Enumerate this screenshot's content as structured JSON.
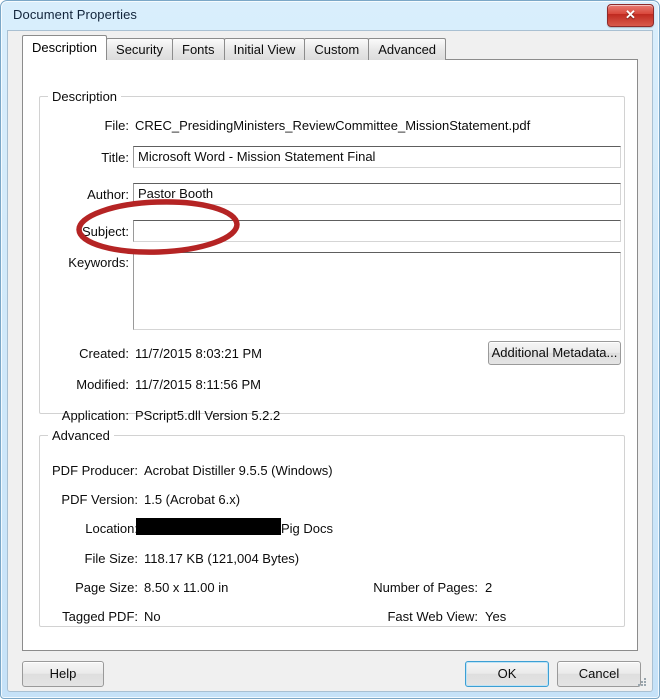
{
  "window": {
    "title": "Document Properties",
    "close_label": "✕",
    "close_icon": "close-icon"
  },
  "tabs": [
    {
      "label": "Description",
      "active": true
    },
    {
      "label": "Security",
      "active": false
    },
    {
      "label": "Fonts",
      "active": false
    },
    {
      "label": "Initial View",
      "active": false
    },
    {
      "label": "Custom",
      "active": false
    },
    {
      "label": "Advanced",
      "active": false
    }
  ],
  "description": {
    "group_title": "Description",
    "file": {
      "label": "File:",
      "value": "CREC_PresidingMinisters_ReviewCommittee_MissionStatement.pdf"
    },
    "title_field": {
      "label": "Title:",
      "value": "Microsoft Word - Mission Statement Final",
      "placeholder": ""
    },
    "author_field": {
      "label": "Author:",
      "value": "Pastor Booth",
      "placeholder": ""
    },
    "subject_field": {
      "label": "Subject:",
      "value": "",
      "placeholder": ""
    },
    "keywords_field": {
      "label": "Keywords:",
      "value": "",
      "placeholder": ""
    },
    "created": {
      "label": "Created:",
      "value": "11/7/2015 8:03:21 PM"
    },
    "modified": {
      "label": "Modified:",
      "value": "11/7/2015 8:11:56 PM"
    },
    "application": {
      "label": "Application:",
      "value": "PScript5.dll Version 5.2.2"
    },
    "additional_metadata_button": "Additional Metadata..."
  },
  "advanced": {
    "group_title": "Advanced",
    "pdf_producer": {
      "label": "PDF Producer:",
      "value": "Acrobat Distiller 9.5.5 (Windows)"
    },
    "pdf_version": {
      "label": "PDF Version:",
      "value": "1.5 (Acrobat 6.x)"
    },
    "location": {
      "label": "Location:",
      "value": "Pig Docs",
      "redacted": true
    },
    "file_size": {
      "label": "File Size:",
      "value": "118.17 KB (121,004 Bytes)"
    },
    "page_size": {
      "label": "Page Size:",
      "value": "8.50 x 11.00 in"
    },
    "number_of_pages": {
      "label": "Number of Pages:",
      "value": "2"
    },
    "tagged_pdf": {
      "label": "Tagged PDF:",
      "value": "No"
    },
    "fast_web_view": {
      "label": "Fast Web View:",
      "value": "Yes"
    }
  },
  "footer": {
    "help_button": "Help",
    "ok_button": "OK",
    "cancel_button": "Cancel"
  },
  "annotation": {
    "name": "author-highlight-ellipse",
    "color": "#b52424",
    "stroke_width": 5
  }
}
